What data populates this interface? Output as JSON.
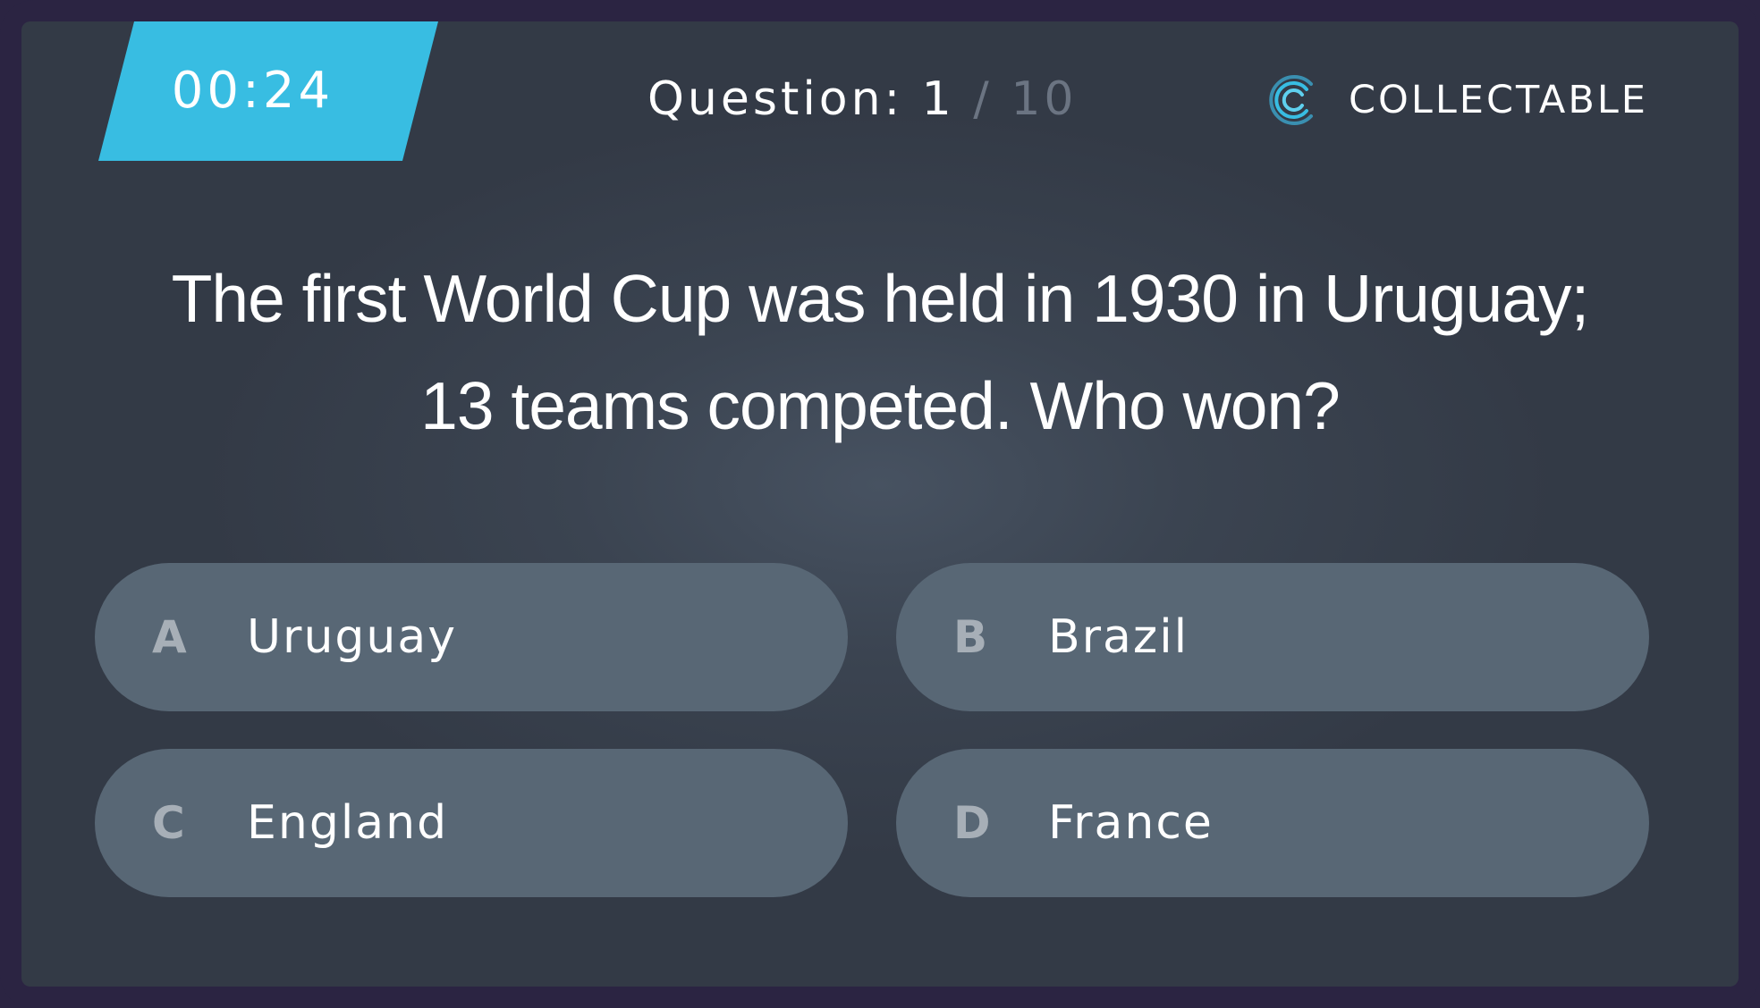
{
  "timer": {
    "time": "00:24",
    "color": "#38bde2"
  },
  "counter": {
    "prefix": "Question:",
    "current": "1",
    "separator": "/",
    "total": "10"
  },
  "brand": {
    "icon": "collectable-logo-icon",
    "name": "COLLECTABLE"
  },
  "question": {
    "line1": "The first World Cup was held in 1930 in Uruguay;",
    "line2": "13 teams competed. Who won?"
  },
  "answers": [
    {
      "letter": "A",
      "label": "Uruguay"
    },
    {
      "letter": "B",
      "label": "Brazil"
    },
    {
      "letter": "C",
      "label": "England"
    },
    {
      "letter": "D",
      "label": "France"
    }
  ]
}
